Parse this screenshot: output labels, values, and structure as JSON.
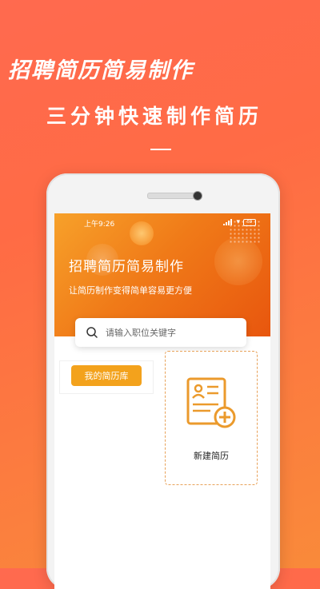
{
  "promo": {
    "title": "招聘简历简易制作",
    "subtitle": "三分钟快速制作简历"
  },
  "status_bar": {
    "time": "上午9:26",
    "battery": "59"
  },
  "app": {
    "title": "招聘简历简易制作",
    "subtitle": "让简历制作变得简单容易更方便"
  },
  "search": {
    "placeholder": "请输入职位关键字"
  },
  "actions": {
    "my_library": "我的简历库",
    "new_resume": "新建简历"
  },
  "colors": {
    "background": "#ff6a4f",
    "header_orange": "#f07a18",
    "button_orange": "#f3a21c",
    "icon_orange": "#eb9a2c"
  }
}
